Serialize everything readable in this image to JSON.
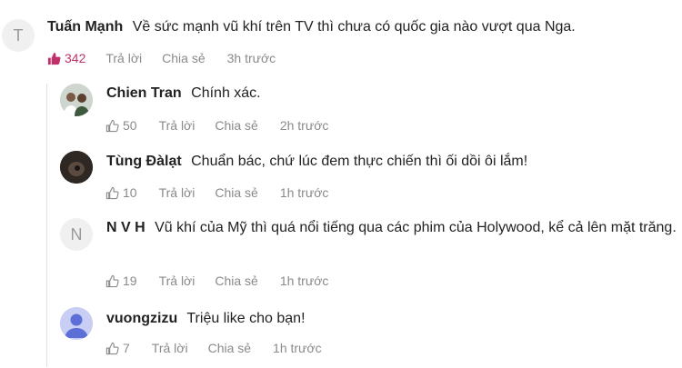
{
  "comments": [
    {
      "author": "Tuấn Mạnh",
      "avatar_letter": "T",
      "text": "Về sức mạnh vũ khí trên TV thì chưa có quốc gia nào vượt qua Nga.",
      "likes": "342",
      "reply_label": "Trả lời",
      "share_label": "Chia sẻ",
      "time": "3h trước",
      "liked_color": "#c0306a"
    },
    {
      "author": "Chien Tran",
      "text": "Chính xác.",
      "likes": "50",
      "reply_label": "Trả lời",
      "share_label": "Chia sẻ",
      "time": "2h trước"
    },
    {
      "author": "Tùng Đàlạt",
      "text": "Chuẩn bác, chứ lúc đem thực chiến thì ối dồi ôi lắm!",
      "likes": "10",
      "reply_label": "Trả lời",
      "share_label": "Chia sẻ",
      "time": "1h trước"
    },
    {
      "author": "N V H",
      "avatar_letter": "N",
      "text": "Vũ khí của Mỹ thì quá nổi tiếng qua các phim của Holywood, kể cả lên mặt trăng.",
      "likes": "19",
      "reply_label": "Trả lời",
      "share_label": "Chia sẻ",
      "time": "1h trước"
    },
    {
      "author": "vuongzizu",
      "text": "Triệu like cho bạn!",
      "likes": "7",
      "reply_label": "Trả lời",
      "share_label": "Chia sẻ",
      "time": "1h trước"
    }
  ]
}
